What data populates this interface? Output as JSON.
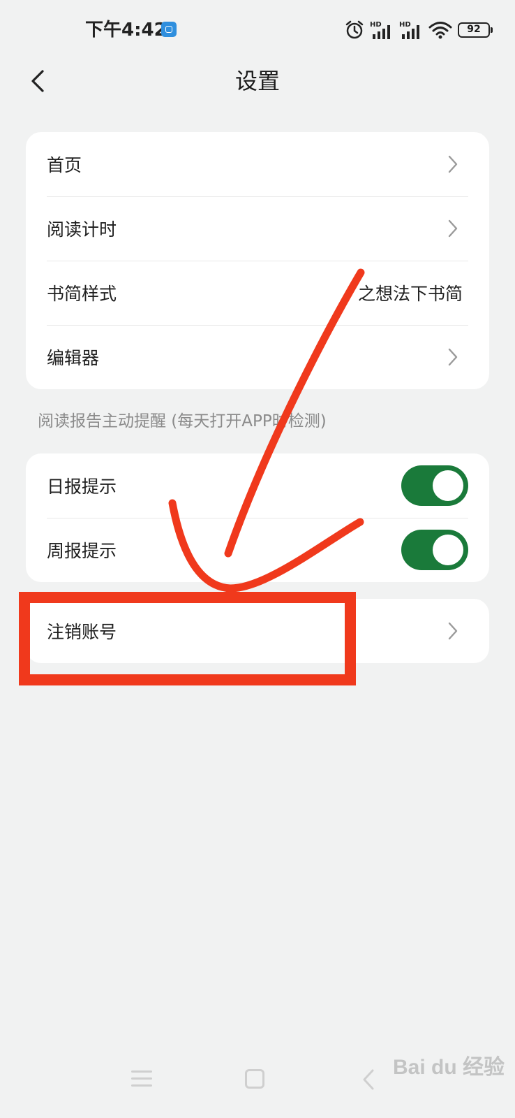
{
  "status_bar": {
    "time": "下午4:42",
    "network_labels": [
      "HD",
      "HD"
    ],
    "battery": "92"
  },
  "header": {
    "title": "设置"
  },
  "general_settings": [
    {
      "label": "首页",
      "value": "",
      "has_chevron": true
    },
    {
      "label": "阅读计时",
      "value": "",
      "has_chevron": true
    },
    {
      "label": "书简样式",
      "value": "之想法下书简",
      "has_chevron": false
    },
    {
      "label": "编辑器",
      "value": "",
      "has_chevron": true
    }
  ],
  "report_section": {
    "title": "阅读报告主动提醒 (每天打开APP时检测)",
    "items": [
      {
        "label": "日报提示",
        "enabled": true
      },
      {
        "label": "周报提示",
        "enabled": true
      }
    ]
  },
  "account": {
    "label": "注销账号"
  },
  "watermark": "Bai du 经验",
  "colors": {
    "background": "#f1f2f2",
    "toggle_on": "#1a7a3a",
    "annotation": "#f0391c"
  }
}
